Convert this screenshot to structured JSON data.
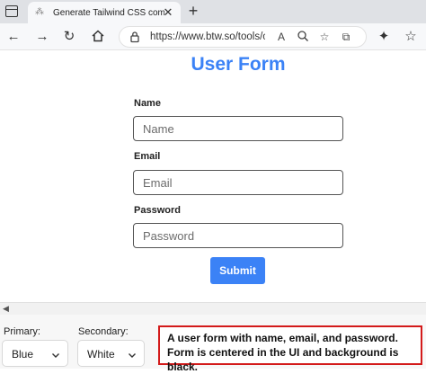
{
  "browser": {
    "tab_title": "Generate Tailwind CSS componen",
    "url": "https://www.btw.so/tools/chat-gp"
  },
  "form": {
    "title": "User Form",
    "name_label": "Name",
    "name_placeholder": "Name",
    "email_label": "Email",
    "email_placeholder": "Email",
    "password_label": "Password",
    "password_placeholder": "Password",
    "submit_label": "Submit"
  },
  "controls": {
    "primary_label": "Primary:",
    "primary_value": "Blue",
    "secondary_label": "Secondary:",
    "secondary_value": "White"
  },
  "description": "A user form with name, email, and password. Form is centered in the UI and background is black.",
  "colors": {
    "accent": "#3b82f6",
    "highlight_border": "#d31a1a"
  }
}
